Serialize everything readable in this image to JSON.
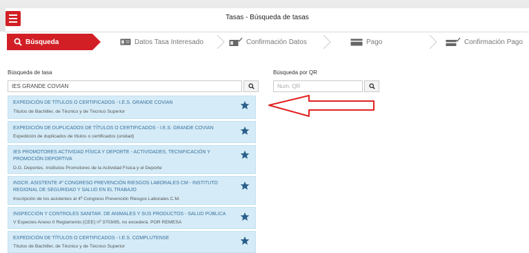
{
  "header": {
    "title": "Tasas - Búsqueda de tasas",
    "menu_icon": "hamburger-icon"
  },
  "steps": [
    {
      "label": "Búsqueda",
      "icon": "search-icon",
      "active": true
    },
    {
      "label": "Datos Tasa Interesado",
      "icon": "id-card-icon",
      "active": false
    },
    {
      "label": "Confirmación Datos",
      "icon": "card-check-icon",
      "active": false
    },
    {
      "label": "Pago",
      "icon": "credit-card-icon",
      "active": false
    },
    {
      "label": "Confirmación Pago",
      "icon": "card-check-icon",
      "active": false
    }
  ],
  "search": {
    "label": "Búsqueda de tasa",
    "value": "IES GRANDE COVIAN",
    "qr_label": "Búsqueda por QR",
    "qr_placeholder": "Num. QR"
  },
  "results": [
    {
      "title": "EXPEDICIÓN DE TÍTULOS O CERTIFICADOS - I.E.S. GRANDE COVIAN",
      "description": "Títulos de Bachiller, de Técnico y de Técnico Superior"
    },
    {
      "title": "EXPEDICIÓN DE DUPLICADOS DE TÍTULOS O CERTIFICADOS - I.E.S. GRANDE COVIAN",
      "description": "Expedición de duplicados de títulos o certificados (unidad)"
    },
    {
      "title": "IES PROMOTORES ACTIVIDAD FÍSICA Y DEPORTE - ACTIVIDADES, TECNIFICACIÓN Y PROMOCIÓN DEPORTIVA",
      "description": "D.G. Deportes. Institutos Promotores de la Actividad Física y el Deporte"
    },
    {
      "title": "INSCR. ASISTENTE 4º CONGRESO PREVENCIÓN RIESGOS LABORALES CM - INSTITUTO REGIONAL DE SEGURIDAD Y SALUD EN EL TRABAJO",
      "description": "Inscripción de los asistentes al 4º Congreso Prevención Riesgos Laborales C.M."
    },
    {
      "title": "INSPECCIÓN Y CONTROLES SANITAR. DE ANIMALES Y SUS PRODUCTOS - SALUD PÚBLICA",
      "description": "V Especies Anexo II Reglamento (CEE) nº 3703/85, no excederá. POR REMESA"
    },
    {
      "title": "EXPEDICIÓN DE TÍTULOS O CERTIFICADOS - I.E.S. COMPLUTENSE",
      "description": "Títulos de Bachiller, de Técnico y de Técnico Superior"
    }
  ],
  "colors": {
    "accent": "#d21f26",
    "result_bg": "#d5ecf8",
    "result_title": "#3a6f9a",
    "star": "#2a5f8a",
    "arrow": "#e02020"
  }
}
